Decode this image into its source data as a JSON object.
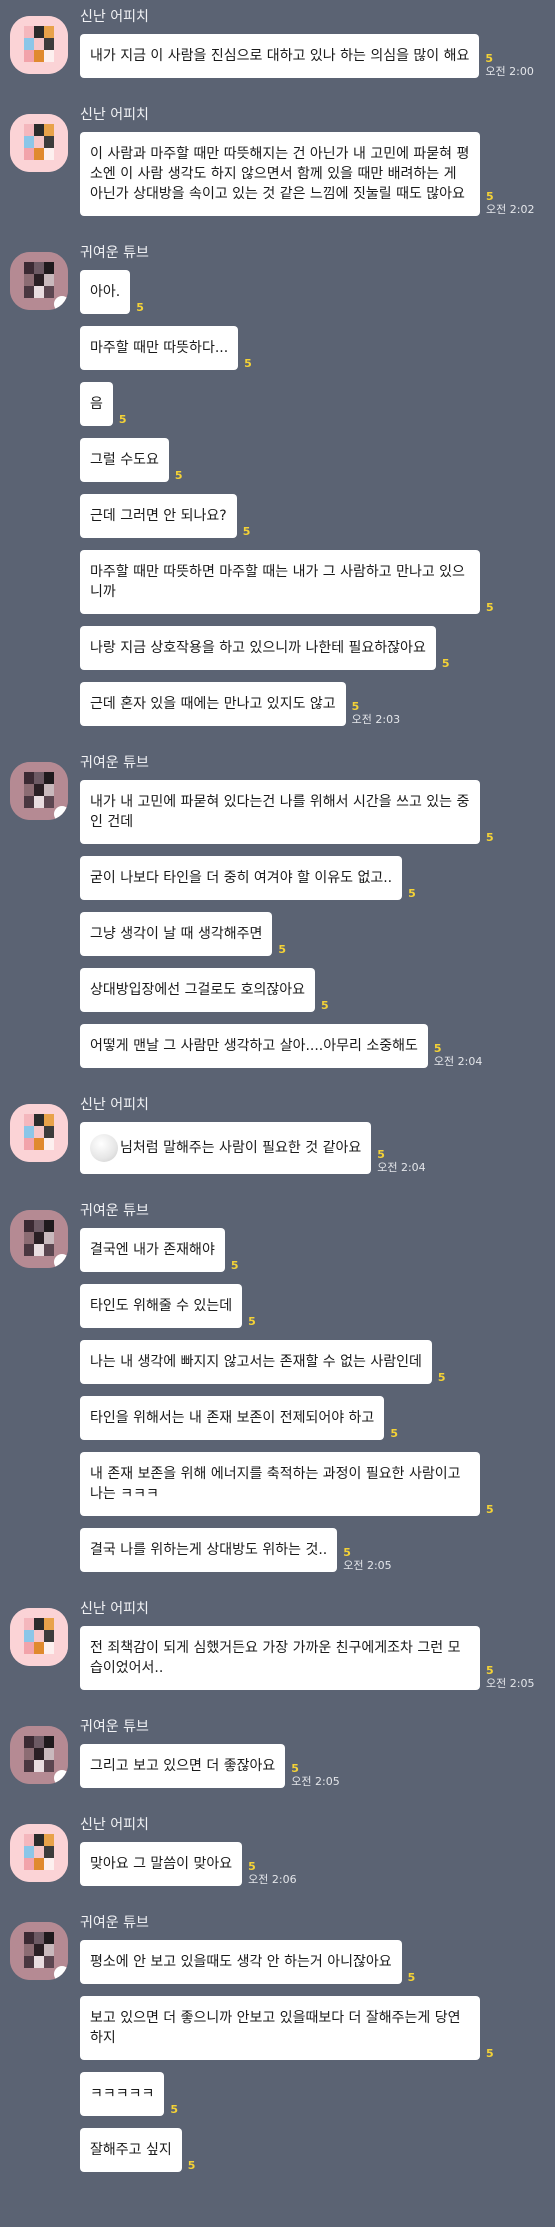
{
  "colors": {
    "background": "#5b6373",
    "bubble": "#ffffff",
    "unread": "#f4d236"
  },
  "groups": [
    {
      "sender": "신난 어피치",
      "avatar": "apeach",
      "messages": [
        {
          "text": "내가 지금 이 사람을 진심으로 대하고 있나 하는 의심을 많이 해요",
          "unread": "5",
          "time": "오전 2:00"
        }
      ]
    },
    {
      "sender": "신난 어피치",
      "avatar": "apeach",
      "messages": [
        {
          "text": "이 사람과 마주할 때만 따뜻해지는 건 아닌가 내 고민에 파묻혀 평소엔 이 사람 생각도 하지 않으면서 함께 있을 때만 배려하는 게 아닌가 상대방을 속이고 있는 것 같은 느낌에 짓눌릴 때도 많아요",
          "unread": "5",
          "time": "오전 2:02"
        }
      ]
    },
    {
      "sender": "귀여운 튜브",
      "avatar": "tube",
      "messages": [
        {
          "text": "아아.",
          "unread": "5",
          "time": ""
        },
        {
          "text": "마주할 때만 따뜻하다...",
          "unread": "5",
          "time": ""
        },
        {
          "text": "음",
          "unread": "5",
          "time": ""
        },
        {
          "text": "그럴 수도요",
          "unread": "5",
          "time": ""
        },
        {
          "text": "근데 그러면 안 되나요?",
          "unread": "5",
          "time": ""
        },
        {
          "text": "마주할 때만 따뜻하면 마주할 때는 내가 그 사람하고 만나고 있으니까",
          "unread": "5",
          "time": ""
        },
        {
          "text": "나랑 지금 상호작용을 하고 있으니까 나한테 필요하잖아요",
          "unread": "5",
          "time": ""
        },
        {
          "text": "근데 혼자 있을 때에는 만나고 있지도 않고",
          "unread": "5",
          "time": "오전 2:03"
        }
      ]
    },
    {
      "sender": "귀여운 튜브",
      "avatar": "tube",
      "messages": [
        {
          "text": "내가 내 고민에 파묻혀 있다는건 나를 위해서 시간을 쓰고 있는 중인 건데",
          "unread": "5",
          "time": ""
        },
        {
          "text": "굳이 나보다 타인을 더 중히 여겨야 할 이유도 없고..",
          "unread": "5",
          "time": ""
        },
        {
          "text": "그냥 생각이 날 때 생각해주면",
          "unread": "5",
          "time": ""
        },
        {
          "text": "상대방입장에선 그걸로도 호의잖아요",
          "unread": "5",
          "time": ""
        },
        {
          "text": "어떻게 맨날 그 사람만 생각하고 살아....아무리 소중해도",
          "unread": "5",
          "time": "오전 2:04"
        }
      ]
    },
    {
      "sender": "신난 어피치",
      "avatar": "apeach",
      "messages": [
        {
          "text": "님처럼 말해주는 사람이 필요한 것 같아요",
          "emoji": true,
          "unread": "5",
          "time": "오전 2:04"
        }
      ]
    },
    {
      "sender": "귀여운 튜브",
      "avatar": "tube",
      "messages": [
        {
          "text": "결국엔 내가 존재해야",
          "unread": "5",
          "time": ""
        },
        {
          "text": "타인도 위해줄 수 있는데",
          "unread": "5",
          "time": ""
        },
        {
          "text": "나는 내 생각에 빠지지 않고서는 존재할 수 없는 사람인데",
          "unread": "5",
          "time": ""
        },
        {
          "text": "타인을 위해서는 내 존재 보존이 전제되어야 하고",
          "unread": "5",
          "time": ""
        },
        {
          "text": "내 존재 보존을 위해 에너지를 축적하는 과정이 필요한 사람이고 나는 ㅋㅋㅋ",
          "unread": "5",
          "time": ""
        },
        {
          "text": "결국 나를 위하는게 상대방도 위하는 것..",
          "unread": "5",
          "time": "오전 2:05"
        }
      ]
    },
    {
      "sender": "신난 어피치",
      "avatar": "apeach",
      "messages": [
        {
          "text": "전 죄책감이 되게 심했거든요 가장 가까운 친구에게조차 그런 모습이었어서..",
          "unread": "5",
          "time": "오전 2:05"
        }
      ]
    },
    {
      "sender": "귀여운 튜브",
      "avatar": "tube",
      "messages": [
        {
          "text": "그리고 보고 있으면 더 좋잖아요",
          "unread": "5",
          "time": "오전 2:05"
        }
      ]
    },
    {
      "sender": "신난 어피치",
      "avatar": "apeach",
      "messages": [
        {
          "text": "맞아요 그 말씀이 맞아요",
          "unread": "5",
          "time": "오전 2:06"
        }
      ]
    },
    {
      "sender": "귀여운 튜브",
      "avatar": "tube",
      "messages": [
        {
          "text": "평소에 안 보고 있을때도 생각 안 하는거 아니잖아요",
          "unread": "5",
          "time": ""
        },
        {
          "text": "보고 있으면 더 좋으니까 안보고 있을때보다 더 잘해주는게 당연하지",
          "unread": "5",
          "time": ""
        },
        {
          "text": "ㅋㅋㅋㅋㅋ",
          "unread": "5",
          "time": ""
        },
        {
          "text": "잘해주고 싶지",
          "unread": "5",
          "time": ""
        }
      ]
    }
  ]
}
